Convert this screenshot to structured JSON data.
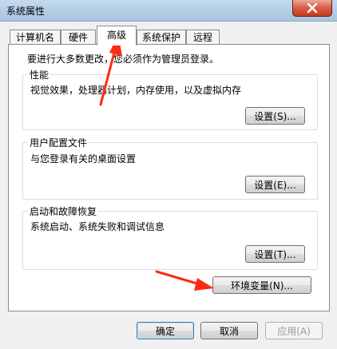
{
  "window": {
    "title": "系统属性"
  },
  "tabs": [
    {
      "label": "计算机名"
    },
    {
      "label": "硬件"
    },
    {
      "label": "高级"
    },
    {
      "label": "系统保护"
    },
    {
      "label": "远程"
    }
  ],
  "intro_text": "要进行大多数更改，您必须作为管理员登录。",
  "groups": {
    "performance": {
      "title": "性能",
      "description": "视觉效果，处理器计划，内存使用，以及虚拟内存",
      "button": "设置(S)..."
    },
    "user_profiles": {
      "title": "用户配置文件",
      "description": "与您登录有关的桌面设置",
      "button": "设置(E)..."
    },
    "startup_recovery": {
      "title": "启动和故障恢复",
      "description": "系统启动、系统失败和调试信息",
      "button": "设置(T)..."
    }
  },
  "env_button": "环境变量(N)...",
  "footer": {
    "ok": "确定",
    "cancel": "取消",
    "apply": "应用(A)"
  },
  "colors": {
    "annotation_arrow": "#ff2a10",
    "close_button": "#c13a21"
  },
  "icons": {
    "close": "close-icon"
  }
}
